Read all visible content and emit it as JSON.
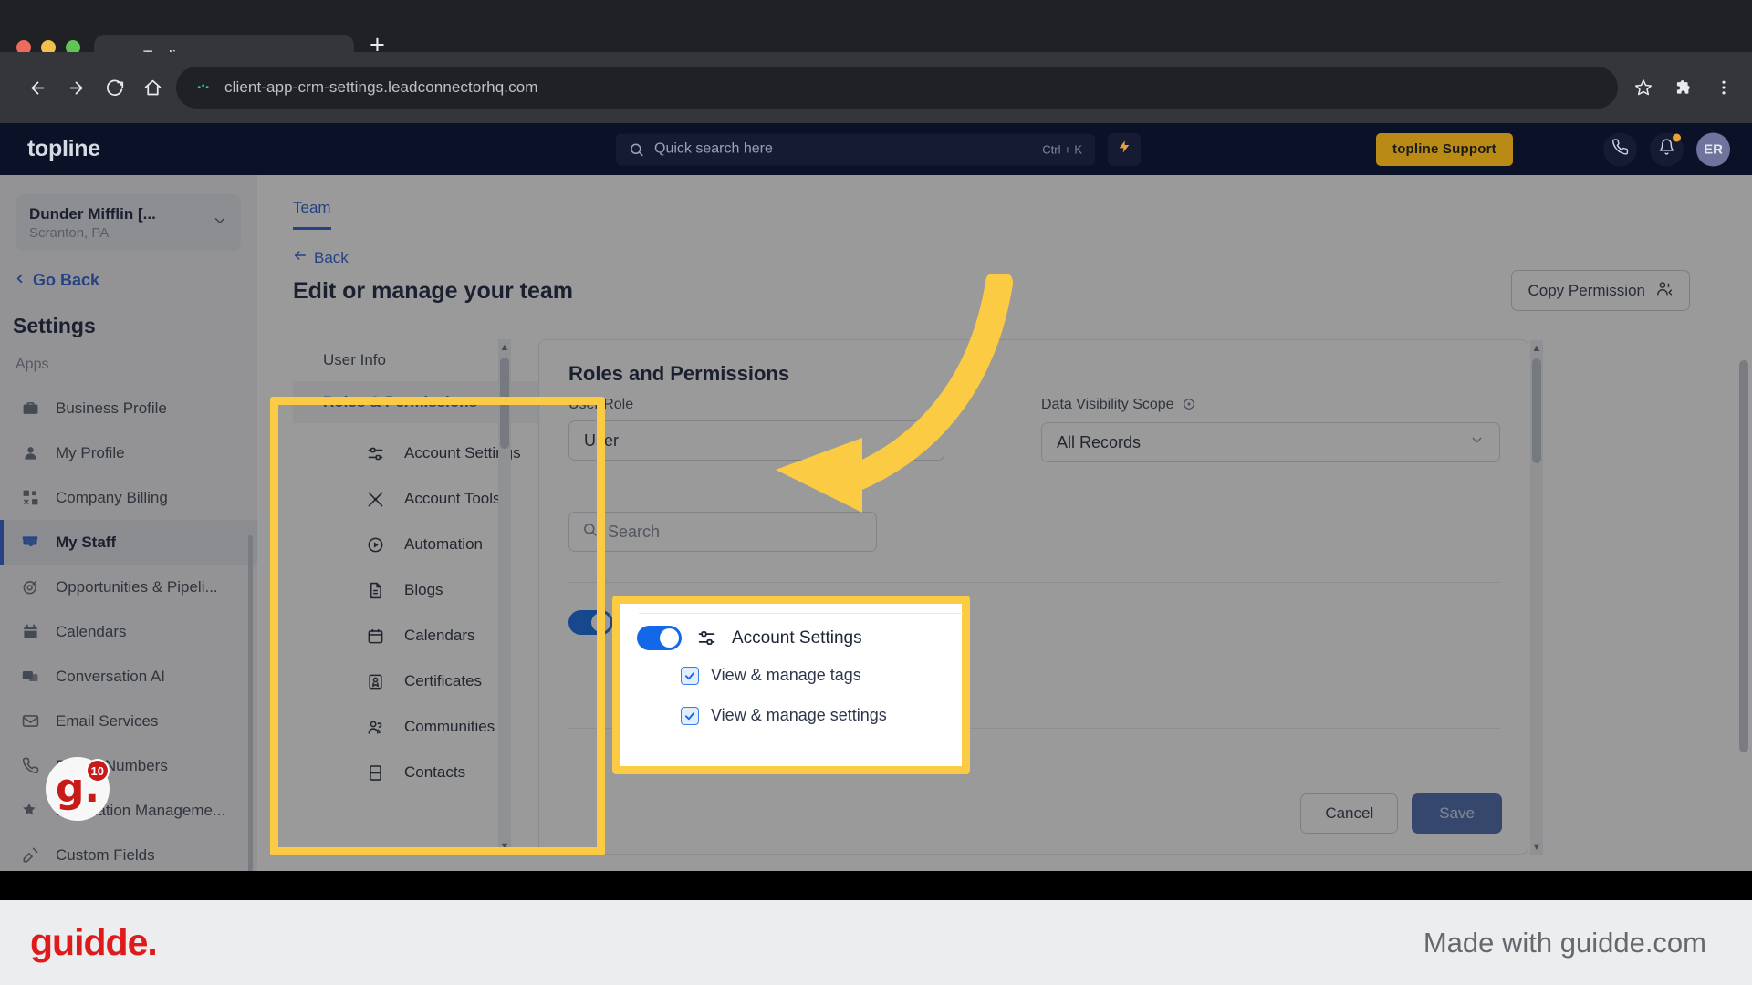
{
  "browser": {
    "tab": {
      "title": "Topline",
      "favicon_icon": "topline-favicon"
    },
    "new_tab_label": "+",
    "url": "client-app-crm-settings.leadconnectorhq.com",
    "nav": {
      "back_icon": "back-arrow-icon",
      "forward_icon": "forward-arrow-icon",
      "reload_icon": "reload-icon",
      "home_icon": "home-icon"
    },
    "toolbar_right": {
      "bookmark_icon": "star-icon",
      "extensions_icon": "puzzle-icon",
      "menu_icon": "kebab-menu-icon"
    }
  },
  "app_header": {
    "brand": "topline",
    "search": {
      "placeholder": "Quick search here",
      "shortcut": "Ctrl + K",
      "icon": "search-icon"
    },
    "bolt_icon": "lightning-bolt-icon",
    "support_button": "topline Support",
    "phone_icon": "phone-icon",
    "bell_icon": "bell-icon",
    "avatar_initials": "ER"
  },
  "sidebar": {
    "location": {
      "name": "Dunder Mifflin [...",
      "sub": "Scranton, PA",
      "chevron_icon": "chevron-down-icon"
    },
    "go_back": "Go Back",
    "go_back_icon": "chevron-left-icon",
    "title": "Settings",
    "section_label": "Apps",
    "items": [
      {
        "label": "Business Profile",
        "icon": "briefcase-icon",
        "active": false
      },
      {
        "label": "My Profile",
        "icon": "user-icon",
        "active": false
      },
      {
        "label": "Company Billing",
        "icon": "billing-grid-icon",
        "active": false
      },
      {
        "label": "My Staff",
        "icon": "inbox-icon",
        "active": true
      },
      {
        "label": "Opportunities & Pipeli...",
        "icon": "target-icon",
        "active": false
      },
      {
        "label": "Calendars",
        "icon": "calendar-icon",
        "active": false
      },
      {
        "label": "Conversation AI",
        "icon": "chat-icon",
        "active": false
      },
      {
        "label": "Email Services",
        "icon": "envelope-icon",
        "active": false
      },
      {
        "label": "Phone Numbers",
        "icon": "phone-icon",
        "active": false
      },
      {
        "label": "Reputation Manageme...",
        "icon": "star-icon",
        "active": false
      },
      {
        "label": "Custom Fields",
        "icon": "custom-fields-icon",
        "active": false
      }
    ]
  },
  "main": {
    "tab_label": "Team",
    "back_link": "Back",
    "back_icon": "arrow-left-icon",
    "page_title": "Edit or manage your team",
    "copy_permission_button": "Copy Permission",
    "copy_permission_icon": "user-copy-icon"
  },
  "subpanel": {
    "user_info_label": "User Info",
    "roles_header": "Roles & Permissions",
    "roles_chevron_icon": "chevron-up-icon",
    "items": [
      {
        "label": "Account Settings",
        "icon": "sliders-icon"
      },
      {
        "label": "Account Tools",
        "icon": "tools-icon"
      },
      {
        "label": "Automation",
        "icon": "play-circle-icon"
      },
      {
        "label": "Blogs",
        "icon": "document-icon"
      },
      {
        "label": "Calendars",
        "icon": "calendar-icon"
      },
      {
        "label": "Certificates",
        "icon": "certificate-icon"
      },
      {
        "label": "Communities",
        "icon": "people-icon"
      },
      {
        "label": "Contacts",
        "icon": "contact-book-icon"
      }
    ]
  },
  "roles_card": {
    "title": "Roles and Permissions",
    "user_role_label": "User Role",
    "user_role_value": "User",
    "data_scope_label": "Data Visibility Scope",
    "data_scope_info_icon": "info-icon",
    "data_scope_value": "All Records",
    "search_placeholder": "Search",
    "search_icon": "search-icon",
    "permission_group": {
      "toggle_on": true,
      "label": "Account Settings",
      "icon": "sliders-icon",
      "checkboxes": [
        {
          "label": "View & manage tags",
          "checked": true
        },
        {
          "label": "View & manage settings",
          "checked": true
        }
      ]
    },
    "cancel_button": "Cancel",
    "save_button": "Save"
  },
  "guidde_badge": {
    "letter": "g.",
    "count": "10"
  },
  "footer": {
    "logo": "guidde.",
    "made_with": "Made with guidde.com"
  },
  "colors": {
    "accent_blue": "#2C5FD6",
    "highlight_yellow": "#FBCB43",
    "brand_red": "#E01A1A",
    "support_gold": "#B98B16",
    "toggle_blue": "#1268E8"
  }
}
